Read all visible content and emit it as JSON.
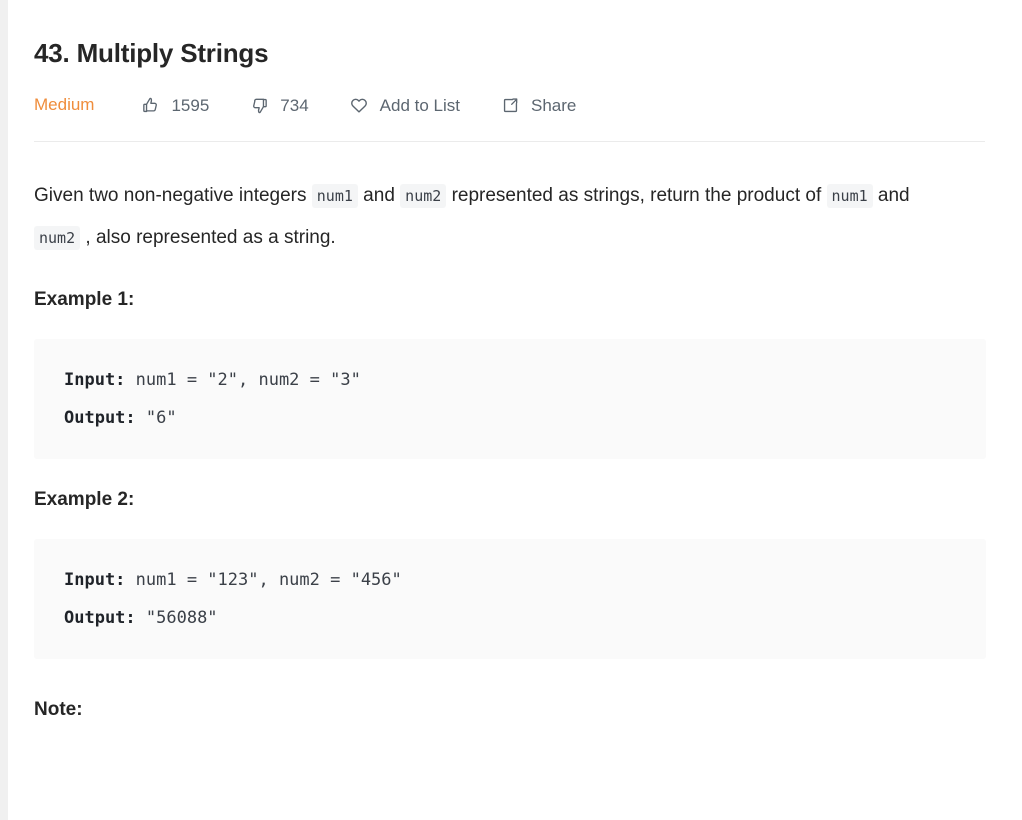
{
  "problem": {
    "title": "43. Multiply Strings",
    "difficulty": "Medium",
    "difficulty_color": "#ef8d3c"
  },
  "actions": [
    {
      "icon": "thumbs-up-icon",
      "label": "1595"
    },
    {
      "icon": "thumbs-down-icon",
      "label": "734"
    },
    {
      "icon": "heart-icon",
      "label": "Add to List"
    },
    {
      "icon": "share-icon",
      "label": "Share"
    }
  ],
  "description": {
    "part1": "Given two non-negative integers ",
    "code1": "num1",
    "part2": " and ",
    "code2": "num2",
    "part3": " represented as strings, return the product of ",
    "code3": "num1",
    "part4": " and ",
    "code4": "num2",
    "part5": " , also represented as a string."
  },
  "examples": [
    {
      "heading": "Example 1:",
      "input_label": "Input:",
      "input_value": " num1 = \"2\", num2 = \"3\"",
      "output_label": "Output:",
      "output_value": " \"6\""
    },
    {
      "heading": "Example 2:",
      "input_label": "Input:",
      "input_value": " num1 = \"123\", num2 = \"456\"",
      "output_label": "Output:",
      "output_value": " \"56088\""
    }
  ],
  "note": {
    "heading": "Note:"
  }
}
